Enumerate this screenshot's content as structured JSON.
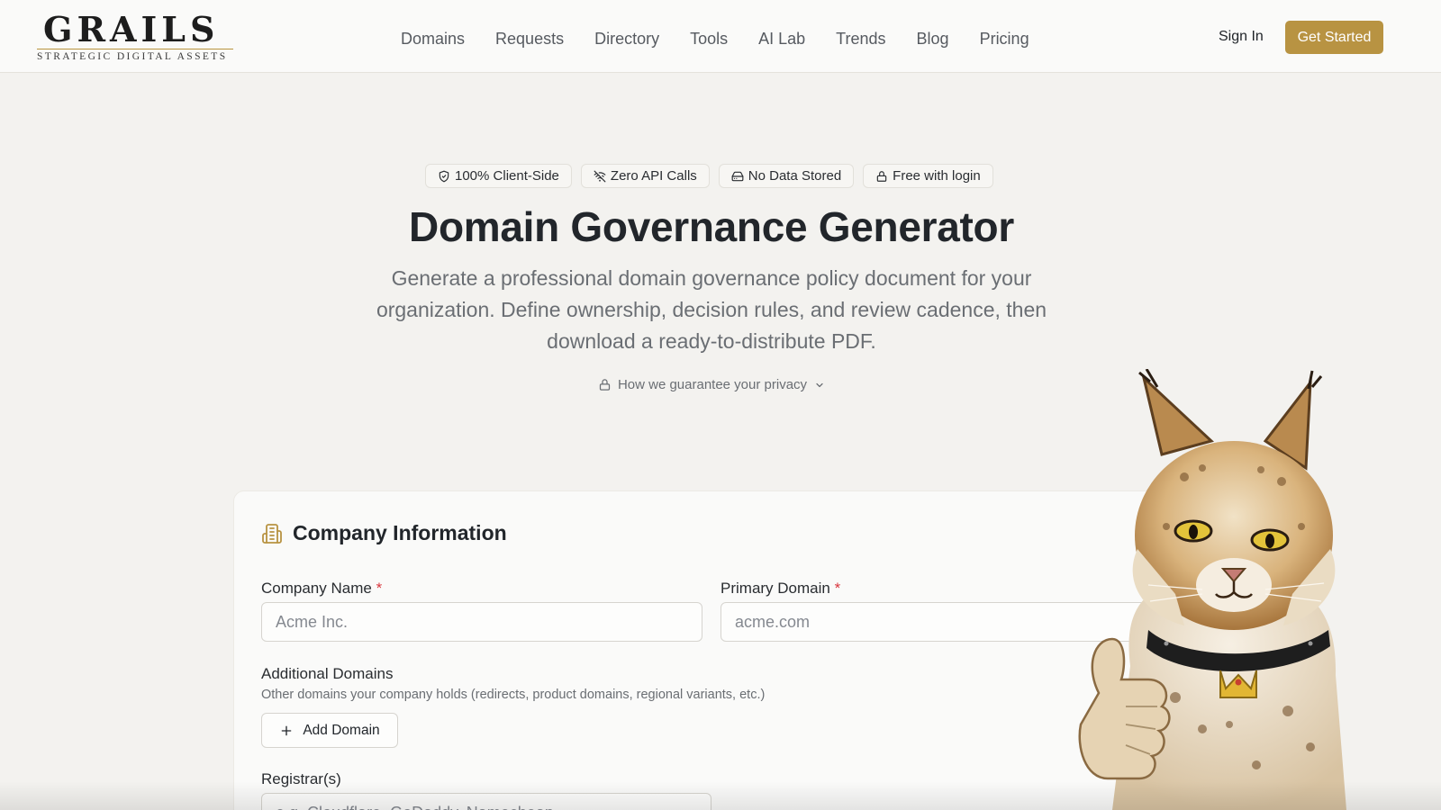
{
  "brand": {
    "name": "GRAILS",
    "tagline": "STRATEGIC DIGITAL ASSETS",
    "accent": "#b89342"
  },
  "nav": {
    "items": [
      {
        "label": "Domains"
      },
      {
        "label": "Requests"
      },
      {
        "label": "Directory"
      },
      {
        "label": "Tools"
      },
      {
        "label": "AI Lab"
      },
      {
        "label": "Trends"
      },
      {
        "label": "Blog"
      },
      {
        "label": "Pricing"
      }
    ],
    "sign_in": "Sign In",
    "get_started": "Get Started"
  },
  "hero": {
    "badges": [
      {
        "icon": "shield-icon",
        "label": "100% Client-Side"
      },
      {
        "icon": "wifi-off-icon",
        "label": "Zero API Calls"
      },
      {
        "icon": "drive-icon",
        "label": "No Data Stored"
      },
      {
        "icon": "lock-icon",
        "label": "Free with login"
      }
    ],
    "title": "Domain Governance Generator",
    "subtitle": "Generate a professional domain governance policy document for your organization. Define ownership, decision rules, and review cadence, then download a ready-to-distribute PDF.",
    "privacy_toggle": "How we guarantee your privacy"
  },
  "form": {
    "section_title": "Company Information",
    "section_icon": "building-icon",
    "company_name": {
      "label": "Company Name",
      "required_mark": "*",
      "placeholder": "Acme Inc.",
      "value": ""
    },
    "primary_domain": {
      "label": "Primary Domain",
      "required_mark": "*",
      "placeholder": "acme.com",
      "value": ""
    },
    "additional_domains": {
      "label": "Additional Domains",
      "help": "Other domains your company holds (redirects, product domains, regional variants, etc.)",
      "add_button": "Add Domain"
    },
    "registrars": {
      "label": "Registrar(s)",
      "placeholder": "e.g. Cloudflare, GoDaddy, Namecheap",
      "value": ""
    }
  }
}
